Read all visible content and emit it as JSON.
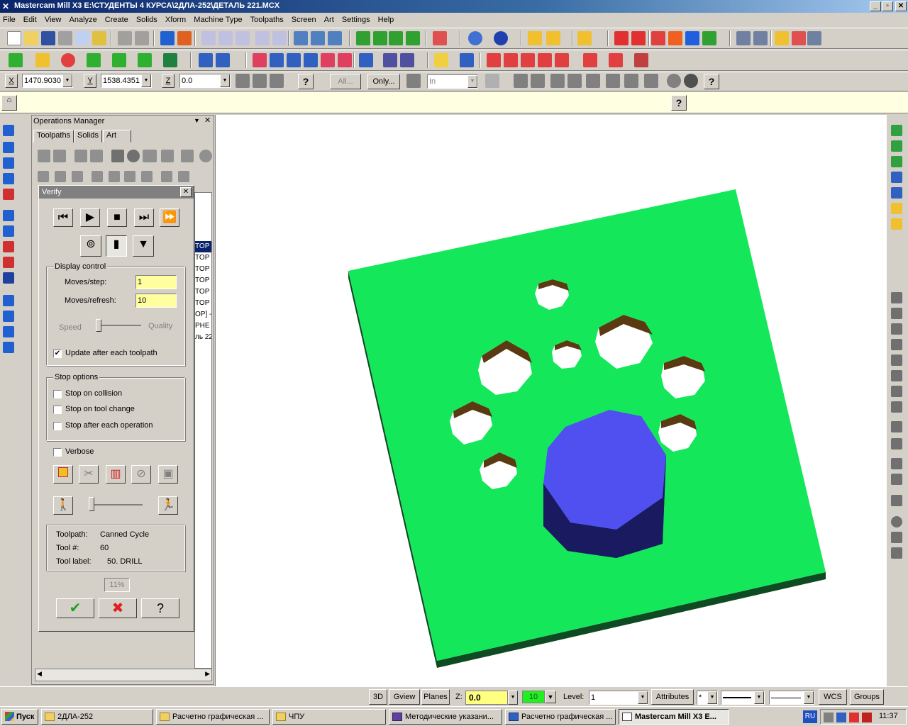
{
  "window": {
    "title": "Mastercam Mill X3  E:\\СТУДЕНТЫ 4 КУРСА\\2ДЛА-252\\ДЕТАЛЬ 221.MCX",
    "min": "_",
    "max": "▫",
    "close": "✕"
  },
  "menu": [
    "File",
    "Edit",
    "View",
    "Analyze",
    "Create",
    "Solids",
    "Xform",
    "Machine Type",
    "Toolpaths",
    "Screen",
    "Art",
    "Settings",
    "Help"
  ],
  "coords": {
    "x_label": "X",
    "x_value": "1470.9030",
    "y_label": "Y",
    "y_value": "1538.4351",
    "z_label": "Z",
    "z_value": "0.0",
    "all_btn": "All...",
    "only_btn": "Only...",
    "in_value": "In"
  },
  "ops_manager": {
    "title": "Operations Manager",
    "close": "✕",
    "pin": "▼",
    "tabs": [
      "Toolpaths",
      "Solids",
      "Art"
    ],
    "list": [
      "TOP",
      "TOP",
      "TOP",
      "TOP",
      "TOP",
      "TOP",
      "OP] -",
      "",
      "PHE",
      "",
      "ль 22"
    ]
  },
  "verify": {
    "title": "Verify",
    "close": "✕",
    "display_control": "Display control",
    "moves_step_label": "Moves/step:",
    "moves_step_value": "1",
    "moves_refresh_label": "Moves/refresh:",
    "moves_refresh_value": "10",
    "speed": "Speed",
    "quality": "Quality",
    "update_after": "Update after each toolpath",
    "stop_options": "Stop options",
    "stop_collision": "Stop on collision",
    "stop_tool_change": "Stop on tool change",
    "stop_each_op": "Stop after each operation",
    "verbose": "Verbose",
    "toolpath_label": "Toolpath:",
    "toolpath_value": "Canned Cycle",
    "tool_num_label": "Tool #:",
    "tool_num_value": "60",
    "tool_label_label": "Tool label:",
    "tool_label_value": "50. DRILL",
    "progress": "11%",
    "ok": "✔",
    "cancel": "✖",
    "help": "?"
  },
  "status": {
    "btn_3d": "3D",
    "gview": "Gview",
    "planes": "Planes",
    "z_label": "Z:",
    "z_value": "0.0",
    "color_value": "10",
    "level_label": "Level:",
    "level_value": "1",
    "attributes": "Attributes",
    "point_style": "*",
    "wcs": "WCS",
    "groups": "Groups"
  },
  "taskbar": {
    "start": "Пуск",
    "tasks": [
      "2ДЛА-252",
      "Расчетно графическая ...",
      "ЧПУ",
      "Методические указани...",
      "Расчетно графическая ...",
      "Mastercam Mill X3  E..."
    ],
    "lang": "RU",
    "clock": "11:37"
  },
  "colors": {
    "stock_top": "#14e85a",
    "stock_side": "#0e4a22",
    "part": "#5050f0",
    "part_side": "#202070",
    "hole_wall": "#5a3a10"
  }
}
